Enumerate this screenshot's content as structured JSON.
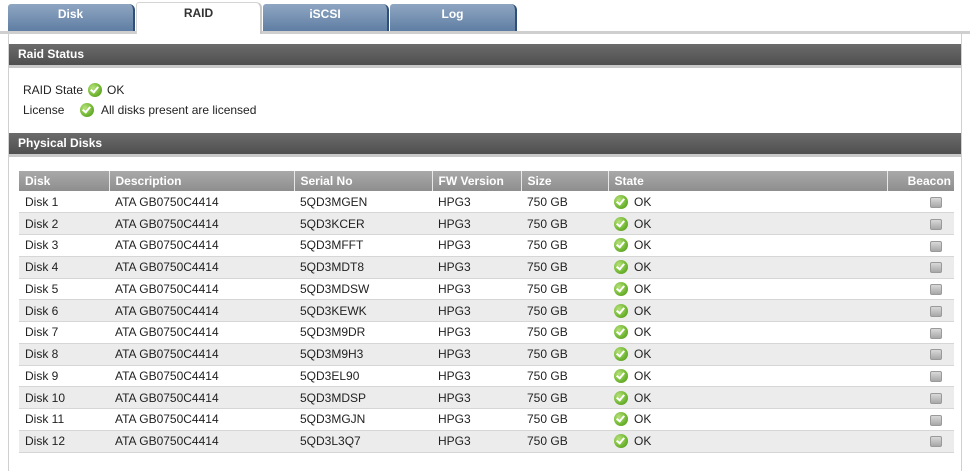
{
  "tabs": [
    {
      "label": "Disk",
      "active": false
    },
    {
      "label": "RAID",
      "active": true
    },
    {
      "label": "iSCSI",
      "active": false
    },
    {
      "label": "Log",
      "active": false
    }
  ],
  "raid_status": {
    "header": "Raid Status",
    "raid_state_label": "RAID State",
    "raid_state_value": "OK",
    "license_label": "License",
    "license_value": "All disks present are licensed"
  },
  "physical_disks": {
    "header": "Physical Disks",
    "columns": [
      "Disk",
      "Description",
      "Serial No",
      "FW Version",
      "Size",
      "State",
      "Beacon"
    ],
    "rows": [
      {
        "disk": "Disk 1",
        "description": "ATA GB0750C4414",
        "serial": "5QD3MGEN",
        "fw": "HPG3",
        "size": "750 GB",
        "state": "OK"
      },
      {
        "disk": "Disk 2",
        "description": "ATA GB0750C4414",
        "serial": "5QD3KCER",
        "fw": "HPG3",
        "size": "750 GB",
        "state": "OK"
      },
      {
        "disk": "Disk 3",
        "description": "ATA GB0750C4414",
        "serial": "5QD3MFFT",
        "fw": "HPG3",
        "size": "750 GB",
        "state": "OK"
      },
      {
        "disk": "Disk 4",
        "description": "ATA GB0750C4414",
        "serial": "5QD3MDT8",
        "fw": "HPG3",
        "size": "750 GB",
        "state": "OK"
      },
      {
        "disk": "Disk 5",
        "description": "ATA GB0750C4414",
        "serial": "5QD3MDSW",
        "fw": "HPG3",
        "size": "750 GB",
        "state": "OK"
      },
      {
        "disk": "Disk 6",
        "description": "ATA GB0750C4414",
        "serial": "5QD3KEWK",
        "fw": "HPG3",
        "size": "750 GB",
        "state": "OK"
      },
      {
        "disk": "Disk 7",
        "description": "ATA GB0750C4414",
        "serial": "5QD3M9DR",
        "fw": "HPG3",
        "size": "750 GB",
        "state": "OK"
      },
      {
        "disk": "Disk 8",
        "description": "ATA GB0750C4414",
        "serial": "5QD3M9H3",
        "fw": "HPG3",
        "size": "750 GB",
        "state": "OK"
      },
      {
        "disk": "Disk 9",
        "description": "ATA GB0750C4414",
        "serial": "5QD3EL90",
        "fw": "HPG3",
        "size": "750 GB",
        "state": "OK"
      },
      {
        "disk": "Disk 10",
        "description": "ATA GB0750C4414",
        "serial": "5QD3MDSP",
        "fw": "HPG3",
        "size": "750 GB",
        "state": "OK"
      },
      {
        "disk": "Disk 11",
        "description": "ATA GB0750C4414",
        "serial": "5QD3MGJN",
        "fw": "HPG3",
        "size": "750 GB",
        "state": "OK"
      },
      {
        "disk": "Disk 12",
        "description": "ATA GB0750C4414",
        "serial": "5QD3L3Q7",
        "fw": "HPG3",
        "size": "750 GB",
        "state": "OK"
      }
    ]
  },
  "icons": {
    "status_ok": "check-circle-icon",
    "beacon": "beacon-icon"
  },
  "colors": {
    "tab_inactive": "#6f8db2",
    "section_header": "#5a5a5a",
    "table_header": "#9c9c9c",
    "ok_green": "#6fb531"
  }
}
